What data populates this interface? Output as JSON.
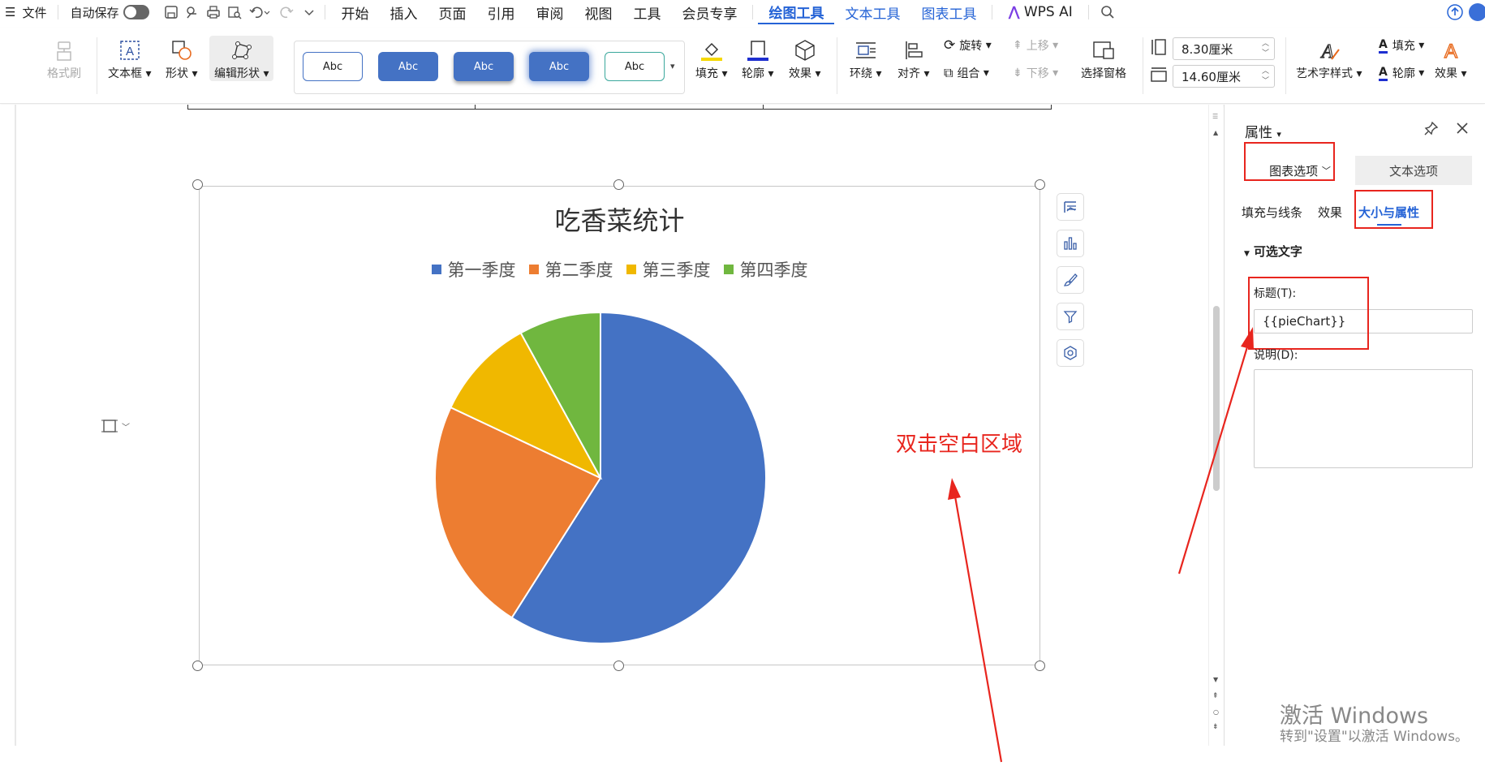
{
  "menubar": {
    "menu_icon": "hamburger-icon",
    "file": "文件",
    "autosave": "自动保存",
    "tabs": [
      "开始",
      "插入",
      "页面",
      "引用",
      "审阅",
      "视图",
      "工具",
      "会员专享"
    ],
    "tool_tabs": [
      "绘图工具",
      "文本工具",
      "图表工具"
    ],
    "wps_ai": "WPS AI"
  },
  "ribbon": {
    "format_painter": "格式刷",
    "textbox": "文本框",
    "shape": "形状",
    "edit_shape": "编辑形状",
    "style_label": "Abc",
    "fill": "填充",
    "outline": "轮廓",
    "effect": "效果",
    "wrap": "环绕",
    "align": "对齐",
    "rotate": "旋转",
    "group": "组合",
    "move_up": "上移",
    "move_down": "下移",
    "selection_pane": "选择窗格",
    "height": "8.30厘米",
    "width": "14.60厘米",
    "art_text_style": "艺术字样式",
    "text_fill": "填充",
    "text_outline": "轮廓",
    "text_effect": "效果"
  },
  "colors": {
    "accent": "#2563d6",
    "annotation_red": "#e8251e"
  },
  "chart_data": {
    "type": "pie",
    "title": "吃香菜统计",
    "categories": [
      "第一季度",
      "第二季度",
      "第三季度",
      "第四季度"
    ],
    "values": [
      59,
      23,
      10,
      8
    ],
    "colors": [
      "#4472c4",
      "#ed7d31",
      "#f0b800",
      "#70b73f"
    ],
    "legend": "top"
  },
  "annotation": "双击空白区域",
  "panel": {
    "title": "属性",
    "tab_chart": "图表选项",
    "tab_text": "文本选项",
    "subtabs": [
      "填充与线条",
      "效果",
      "大小与属性"
    ],
    "section": "可选文字",
    "title_label": "标题(T):",
    "title_value": "{{pieChart}}",
    "desc_label": "说明(D):"
  },
  "watermark": {
    "line1": "激活 Windows",
    "line2": "转到\"设置\"以激活 Windows。"
  }
}
